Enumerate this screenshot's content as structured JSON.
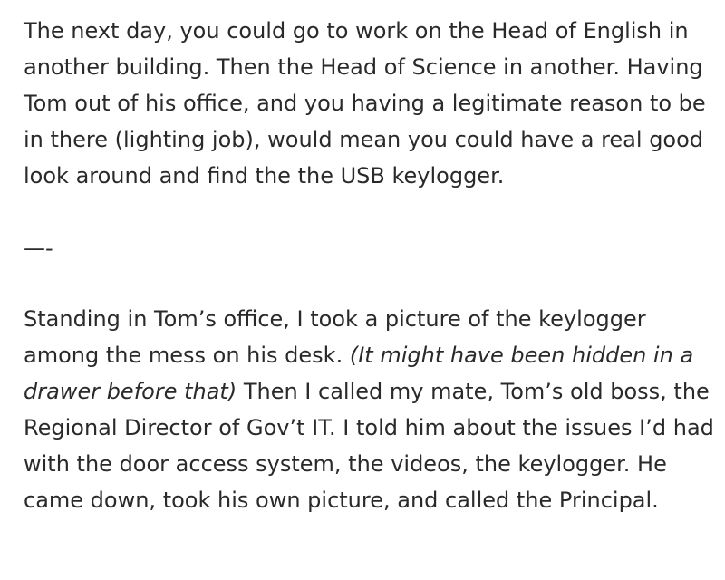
{
  "article": {
    "paragraph_1": "The next day, you could go to work on the Head of English in another building. Then the Head of Science in another. Having Tom out of his office, and you having a legitimate reason to be in there (lighting job), would mean you could have a real good look around and find the the USB keylogger.",
    "divider": "—-",
    "paragraph_2": {
      "before_italic": "Standing in Tom’s office, I took a picture of the keylogger among the mess on his desk. ",
      "italic": "(It might have been hidden in a drawer before that)",
      "after_italic": " Then I called my mate, Tom’s old boss, the Regional Director of Gov’t IT. I told him about the issues I’d had with the door access system, the videos, the keylogger. He came down, took his own picture, and called the Principal."
    }
  }
}
